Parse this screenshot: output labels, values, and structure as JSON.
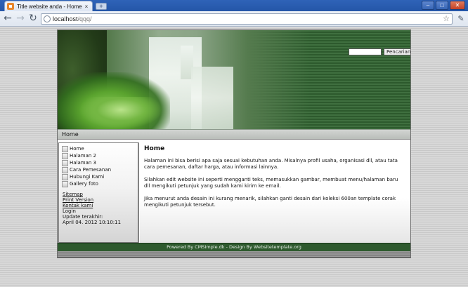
{
  "browser": {
    "tab_title": "Title website anda - Home",
    "tab_close": "×",
    "new_tab": "+",
    "url_host": "localhost",
    "url_path": "/qqq/",
    "win_minimize": "–",
    "win_maximize": "□",
    "win_close": "✕",
    "back": "←",
    "forward": "→",
    "reload": "↻",
    "star": "☆",
    "wrench": "✎",
    "icons": [
      "back-icon",
      "forward-icon",
      "reload-icon",
      "page-icon",
      "star-icon",
      "wrench-icon"
    ]
  },
  "header": {
    "search_value": "",
    "search_button": "Pencarian"
  },
  "breadcrumb": "Home",
  "sidebar": {
    "menu": [
      {
        "label": "Home"
      },
      {
        "label": "Halaman 2"
      },
      {
        "label": "Halaman 3"
      },
      {
        "label": "Cara Pemesanan"
      },
      {
        "label": "Hubungi Kami"
      },
      {
        "label": "Gallery foto"
      }
    ],
    "sitemap": "Sitemap",
    "print_version": "Print Version",
    "contact": "Kontak kami",
    "login": "Login",
    "update_label": "Update terakhir:",
    "update_date": "April 04. 2012 10:10:11"
  },
  "content": {
    "title": "Home",
    "p1": "Halaman ini bisa berisi apa saja sesuai kebutuhan anda. Misalnya profil usaha, organisasi dll, atau tata cara pemesanan, daftar harga, atau informasi lainnya.",
    "p2": "Silahkan edit website ini seperti mengganti teks, memasukkan gambar, membuat menu/halaman baru dll mengikuti petunjuk yang sudah kami kirim ke email.",
    "p3": "Jika menurut anda desain ini kurang menarik, silahkan ganti desain dari koleksi 600an template corak mengikuti petunjuk tersebut."
  },
  "footer": "Powered By CMSImple.dk - Design By Websitetemplate.org",
  "colors": {
    "header_green": "#3f6f3f",
    "footer_green": "#2e5a2e",
    "chrome_blue": "#2f63b8"
  }
}
